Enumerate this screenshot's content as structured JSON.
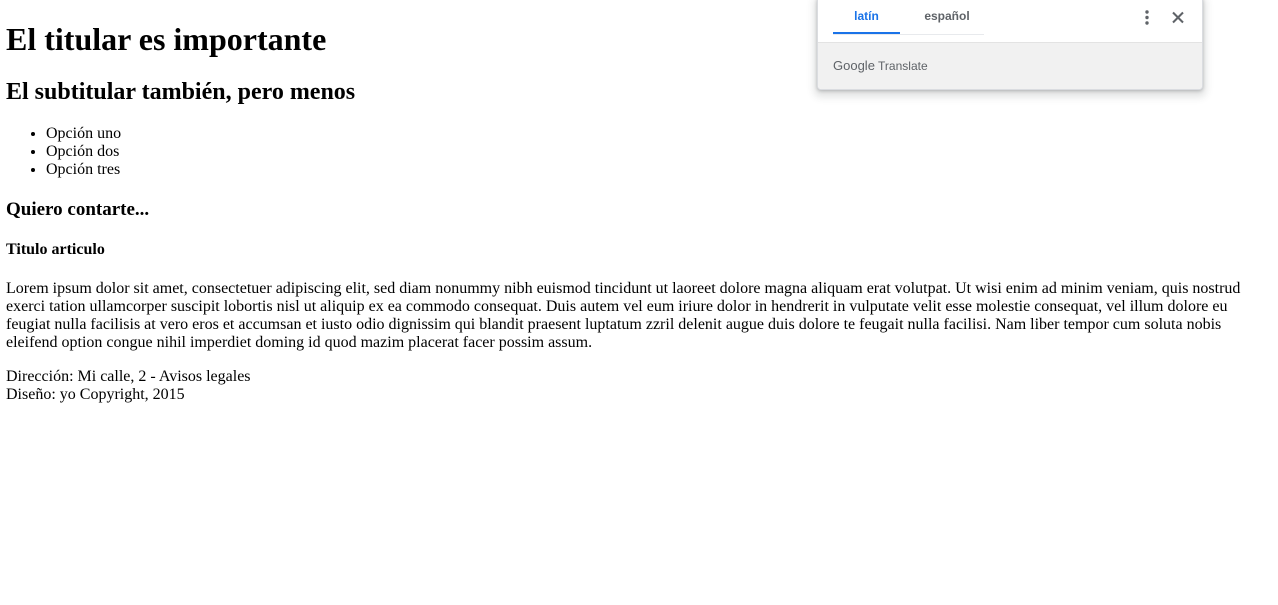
{
  "document": {
    "title": "El titular es importante",
    "subtitle": "El subtitular también, pero menos",
    "list_items": [
      "Opción uno",
      "Opción dos",
      "Opción tres"
    ],
    "section_heading": "Quiero contarte...",
    "article_title": "Titulo articulo",
    "paragraph": "Lorem ipsum dolor sit amet, consectetuer adipiscing elit, sed diam nonummy nibh euismod tincidunt ut laoreet dolore magna aliquam erat volutpat. Ut wisi enim ad minim veniam, quis nostrud exerci tation ullamcorper suscipit lobortis nisl ut aliquip ex ea commodo consequat. Duis autem vel eum iriure dolor in hendrerit in vulputate velit esse molestie consequat, vel illum dolore eu feugiat nulla facilisis at vero eros et accumsan et iusto odio dignissim qui blandit praesent luptatum zzril delenit augue duis dolore te feugait nulla facilisi. Nam liber tempor cum soluta nobis eleifend option congue nihil imperdiet doming id quod mazim placerat facer possim assum.",
    "footer_address": "Dirección: Mi calle, 2 - Avisos legales",
    "footer_design": "Diseño: yo Copyright, 2015"
  },
  "translate_popup": {
    "tabs": [
      {
        "label": "latín",
        "active": true
      },
      {
        "label": "español",
        "active": false
      }
    ],
    "brand_google": "Google",
    "brand_translate": "Translate",
    "icons": {
      "more": "more-vert-icon",
      "close": "close-icon"
    },
    "accent_color": "#1a73e8"
  }
}
